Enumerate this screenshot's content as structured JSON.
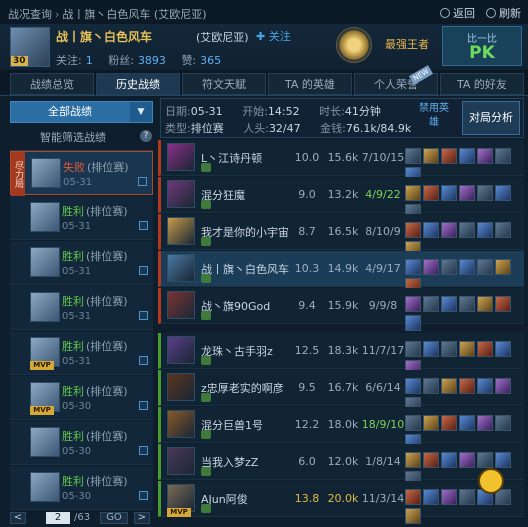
{
  "breadcrumb": {
    "items": [
      "战况查询",
      "战丨旗丶白色风车 (艾欧尼亚)"
    ]
  },
  "nav": {
    "back": "返回",
    "refresh": "刷新"
  },
  "player": {
    "level": "30",
    "name": "战丨旗丶白色风车",
    "region": "(艾欧尼亚)",
    "follow": "关注",
    "follow_label": "关注:",
    "follow_value": "1",
    "fans_label": "粉丝:",
    "fans_value": "3893",
    "praise_label": "赞:",
    "praise_value": "365",
    "rank": "最强王者",
    "pk_label": "比一比",
    "pk_button": "PK"
  },
  "tabs": [
    {
      "label": "战绩总览"
    },
    {
      "label": "历史战绩"
    },
    {
      "label": "符文天赋"
    },
    {
      "label": "TA 的英雄"
    },
    {
      "label": "个人荣誉"
    },
    {
      "label": "TA 的好友"
    }
  ],
  "new_tag": "NEW",
  "filter": {
    "label": "全部战绩",
    "smart": "智能筛选战绩",
    "help": "?"
  },
  "matches": [
    {
      "result": "失败",
      "mode": "(排位赛)",
      "date": "05-31",
      "locked": "尽力局",
      "mvp": false,
      "win": false
    },
    {
      "result": "胜利",
      "mode": "(排位赛)",
      "date": "05-31",
      "mvp": false,
      "win": true
    },
    {
      "result": "胜利",
      "mode": "(排位赛)",
      "date": "05-31",
      "mvp": false,
      "win": true
    },
    {
      "result": "胜利",
      "mode": "(排位赛)",
      "date": "05-31",
      "mvp": false,
      "win": true
    },
    {
      "result": "胜利",
      "mode": "(排位赛)",
      "date": "05-31",
      "mvp": true,
      "win": true
    },
    {
      "result": "胜利",
      "mode": "(排位赛)",
      "date": "05-30",
      "mvp": true,
      "win": true
    },
    {
      "result": "胜利",
      "mode": "(排位赛)",
      "date": "05-30",
      "mvp": false,
      "win": true
    },
    {
      "result": "胜利",
      "mode": "(排位赛)",
      "date": "05-30",
      "mvp": false,
      "win": true
    }
  ],
  "pager": {
    "prev": "<",
    "current": "2",
    "total": "/63",
    "go": "GO",
    "next": ">"
  },
  "match_info": {
    "date_label": "日期:",
    "date": "05-31",
    "start_label": "开始:",
    "start": "14:52",
    "duration_label": "时长:",
    "duration": "41分钟",
    "type_label": "类型:",
    "type": "排位赛",
    "heads_label": "人头:",
    "heads": "32/47",
    "gold_label": "金钱:",
    "gold": "76.1k/84.9k",
    "ban": "禁用英雄",
    "analyze": "对局分析"
  },
  "players": [
    {
      "name": "L丶江诗丹顿",
      "score": "10.0",
      "gold": "15.6k",
      "kda": "7/10/15",
      "team": 1,
      "icon": "#8a2f88"
    },
    {
      "name": "混分狂魔",
      "score": "9.0",
      "gold": "13.2k",
      "kda": "4/9/22",
      "team": 1,
      "icon": "#6e3a7a"
    },
    {
      "name": "我才是你的小宇宙",
      "score": "8.7",
      "gold": "16.5k",
      "kda": "8/10/9",
      "team": 1,
      "icon": "#c59d4a"
    },
    {
      "name": "战丨旗丶白色风车",
      "score": "10.3",
      "gold": "14.9k",
      "kda": "4/9/17",
      "team": 1,
      "icon": "#4a7aa5",
      "hl": true
    },
    {
      "name": "战丶旗90God",
      "score": "9.4",
      "gold": "15.9k",
      "kda": "9/9/8",
      "team": 1,
      "icon": "#7a3535"
    },
    {
      "name": "龙珠丶古手羽z",
      "score": "12.5",
      "gold": "18.3k",
      "kda": "11/7/17",
      "team": 2,
      "icon": "#5a3f8a"
    },
    {
      "name": "z忠厚老实的啊彦",
      "score": "9.5",
      "gold": "16.7k",
      "kda": "6/6/14",
      "team": 2,
      "icon": "#5a3520"
    },
    {
      "name": "混分巨兽1号",
      "score": "12.2",
      "gold": "18.0k",
      "kda": "18/9/10",
      "team": 2,
      "icon": "#8a5a2a"
    },
    {
      "name": "当我入梦zZ",
      "score": "6.0",
      "gold": "12.0k",
      "kda": "1/8/14",
      "team": 2,
      "icon": "#4a3a5a"
    },
    {
      "name": "AJun阿俊",
      "score": "13.8",
      "gold": "20.0k",
      "kda": "11/3/14",
      "team": 2,
      "icon": "#7a6a55",
      "mvp": true
    }
  ]
}
